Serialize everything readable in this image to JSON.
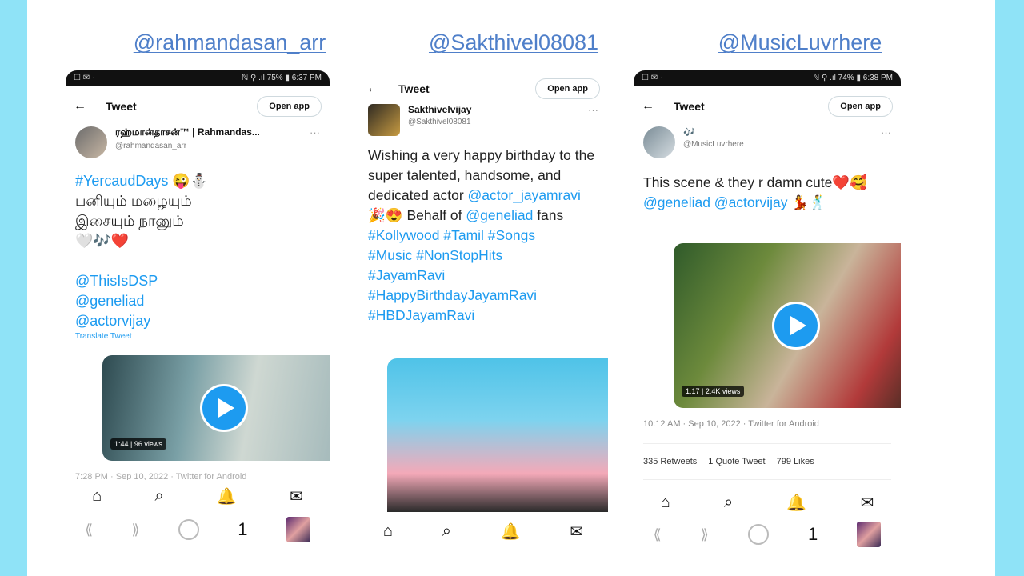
{
  "handles": [
    "@rahmandasan_arr",
    "@Sakthivel08081",
    "@MusicLuvrhere"
  ],
  "phone1": {
    "status_left": "☐ ✉ ·",
    "status_right": "ℕ ⚲ .ıl 75% ▮ 6:37 PM",
    "back": "←",
    "title": "Tweet",
    "open_app": "Open app",
    "display_name": "ரஹ்மான்தாசன்™ | Rahmandas...",
    "username": "@rahmandasan_arr",
    "more": "···",
    "lines": [
      "#YercaudDays 😜⛄",
      "பனியும் மழையும்",
      "இசையும் நானும்",
      "🤍🎶❤️"
    ],
    "mentions": [
      "@ThisIsDSP",
      "@geneliad",
      "@actorvijay"
    ],
    "translate": "Translate Tweet",
    "video_badge": "1:44 | 96 views",
    "meta": "7:28 PM · Sep 10, 2022 · Twitter for Android",
    "nav_icons": [
      "⌂",
      "⌕",
      "🔔",
      "✉"
    ],
    "sys_nav": [
      "⟪",
      "⟫",
      "1"
    ]
  },
  "phone2": {
    "back": "←",
    "title": "Tweet",
    "open_app": "Open app",
    "display_name": "Sakthivelvijay",
    "username": "@Sakthivel08081",
    "more": "···",
    "text1": "Wishing a very happy birthday to the super talented, handsome, and dedicated actor",
    "mention1": "@actor_jayamravi",
    "text2": " 🎉😍 Behalf of ",
    "mention2": "@geneliad",
    "text3": " fans",
    "hashtags": [
      " #Kollywood #Tamil #Songs",
      "#Music #NonStopHits",
      "#JayamRavi",
      "#HappyBirthdayJayamRavi",
      "#HBDJayamRavi"
    ],
    "nav_icons": [
      "⌂",
      "⌕",
      "🔔",
      "✉"
    ]
  },
  "phone3": {
    "status_left": "☐ ✉ ·",
    "status_right": "ℕ ⚲ .ıl 74% ▮ 6:38 PM",
    "back": "←",
    "title": "Tweet",
    "open_app": "Open app",
    "display_name": "🎶",
    "username": "@MusicLuvrhere",
    "more": "···",
    "text1": "This scene & they r damn cute❤️🥰",
    "mentions": "@geneliad @actorvijay 💃🕺",
    "video_badge": "1:17 | 2.4K views",
    "meta": "10:12 AM · Sep 10, 2022 · Twitter for Android",
    "retweets": "335 Retweets",
    "quotes": "1 Quote Tweet",
    "likes": "799 Likes",
    "nav_icons": [
      "⌂",
      "⌕",
      "🔔",
      "✉"
    ],
    "sys_nav": [
      "⟪",
      "⟫",
      "1"
    ]
  }
}
